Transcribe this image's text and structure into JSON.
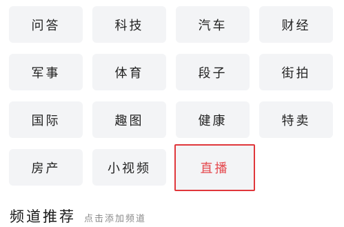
{
  "channels": [
    {
      "label": "问答"
    },
    {
      "label": "科技"
    },
    {
      "label": "汽车"
    },
    {
      "label": "财经"
    },
    {
      "label": "军事"
    },
    {
      "label": "体育"
    },
    {
      "label": "段子"
    },
    {
      "label": "街拍"
    },
    {
      "label": "国际"
    },
    {
      "label": "趣图"
    },
    {
      "label": "健康"
    },
    {
      "label": "特卖"
    },
    {
      "label": "房产"
    },
    {
      "label": "小视频"
    },
    {
      "label": "直播",
      "highlighted": true
    }
  ],
  "recommend": {
    "title": "频道推荐",
    "hint": "点击添加频道"
  },
  "colors": {
    "tile_bg": "#f3f4f6",
    "highlight": "#e0363a",
    "text": "#222222",
    "hint": "#8a8a8a"
  }
}
